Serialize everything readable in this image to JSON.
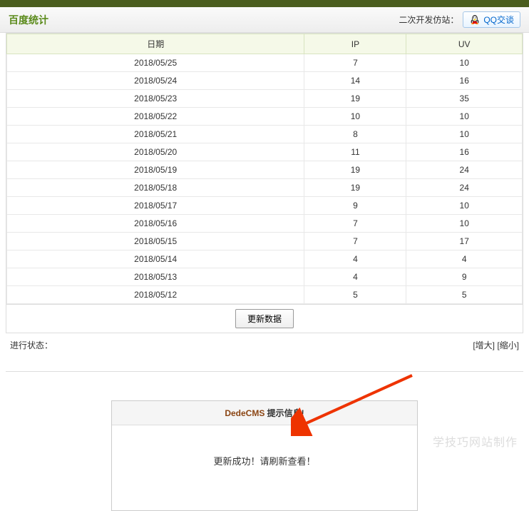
{
  "header": {
    "title": "百度统计",
    "sub_site_label": "二次开发仿站：",
    "qq_label": "QQ交谈"
  },
  "table": {
    "headers": [
      "日期",
      "IP",
      "UV"
    ],
    "rows": [
      {
        "date": "2018/05/25",
        "ip": "7",
        "uv": "10"
      },
      {
        "date": "2018/05/24",
        "ip": "14",
        "uv": "16"
      },
      {
        "date": "2018/05/23",
        "ip": "19",
        "uv": "35"
      },
      {
        "date": "2018/05/22",
        "ip": "10",
        "uv": "10"
      },
      {
        "date": "2018/05/21",
        "ip": "8",
        "uv": "10"
      },
      {
        "date": "2018/05/20",
        "ip": "11",
        "uv": "16"
      },
      {
        "date": "2018/05/19",
        "ip": "19",
        "uv": "24"
      },
      {
        "date": "2018/05/18",
        "ip": "19",
        "uv": "24"
      },
      {
        "date": "2018/05/17",
        "ip": "9",
        "uv": "10"
      },
      {
        "date": "2018/05/16",
        "ip": "7",
        "uv": "10"
      },
      {
        "date": "2018/05/15",
        "ip": "7",
        "uv": "17"
      },
      {
        "date": "2018/05/14",
        "ip": "4",
        "uv": "4"
      },
      {
        "date": "2018/05/13",
        "ip": "4",
        "uv": "9"
      },
      {
        "date": "2018/05/12",
        "ip": "5",
        "uv": "5"
      }
    ]
  },
  "buttons": {
    "update": "更新数据"
  },
  "status": {
    "label": "进行状态：",
    "zoom_in": "[增大]",
    "zoom_out": "[缩小]"
  },
  "message": {
    "brand": "DedeCMS",
    "title_suffix": " 提示信息!",
    "body": "更新成功！请刷新查看！"
  },
  "watermark": "学技巧网站制作"
}
